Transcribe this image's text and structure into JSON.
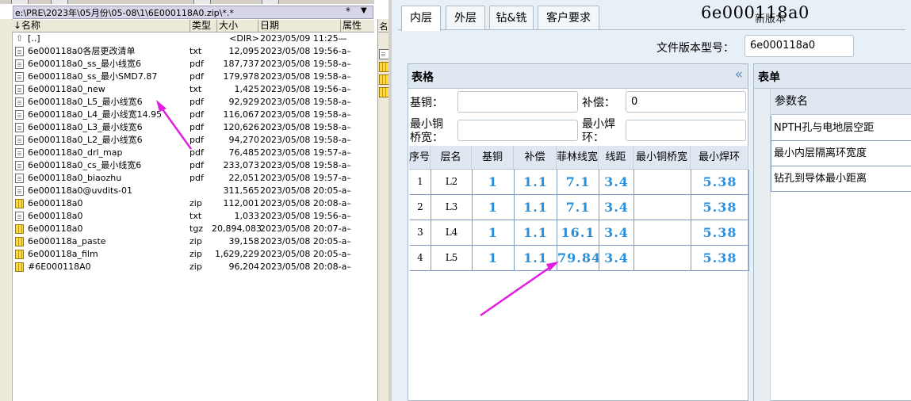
{
  "file_manager": {
    "path": "e:\\PRE\\2023年\\05月份\\05-08\\1\\6E000118A0.zip\\*.*",
    "path_star": "*",
    "path_dropdown_glyph": "▼",
    "columns": {
      "name": "↓名称",
      "type": "类型",
      "size": "大小",
      "date": "日期",
      "attr": "属性"
    },
    "right_column_header": "名",
    "files": [
      {
        "icon": "up-icon",
        "name": "[..]",
        "type": "",
        "size": "<DIR>",
        "date": "2023/05/09 11:25—"
      },
      {
        "icon": "txt-icon",
        "name": "6e000118a0各层更改清单",
        "type": "txt",
        "size": "12,095",
        "date": "2023/05/08 19:56-a–"
      },
      {
        "icon": "txt-icon",
        "name": "6e000118a0_ss_最小线宽6",
        "type": "pdf",
        "size": "187,737",
        "date": "2023/05/08 19:58-a–"
      },
      {
        "icon": "txt-icon",
        "name": "6e000118a0_ss_最小SMD7.87",
        "type": "pdf",
        "size": "179,978",
        "date": "2023/05/08 19:58-a–"
      },
      {
        "icon": "txt-icon",
        "name": "6e000118a0_new",
        "type": "txt",
        "size": "1,425",
        "date": "2023/05/08 19:56-a–"
      },
      {
        "icon": "txt-icon",
        "name": "6e000118a0_L5_最小线宽6",
        "type": "pdf",
        "size": "92,929",
        "date": "2023/05/08 19:58-a–"
      },
      {
        "icon": "txt-icon",
        "name": "6e000118a0_L4_最小线宽14.95",
        "type": "pdf",
        "size": "116,067",
        "date": "2023/05/08 19:58-a–"
      },
      {
        "icon": "txt-icon",
        "name": "6e000118a0_L3_最小线宽6",
        "type": "pdf",
        "size": "120,626",
        "date": "2023/05/08 19:58-a–"
      },
      {
        "icon": "txt-icon",
        "name": "6e000118a0_L2_最小线宽6",
        "type": "pdf",
        "size": "94,270",
        "date": "2023/05/08 19:58-a–"
      },
      {
        "icon": "txt-icon",
        "name": "6e000118a0_drl_map",
        "type": "pdf",
        "size": "76,485",
        "date": "2023/05/08 19:57-a–"
      },
      {
        "icon": "txt-icon",
        "name": "6e000118a0_cs_最小线宽6",
        "type": "pdf",
        "size": "233,073",
        "date": "2023/05/08 19:58-a–"
      },
      {
        "icon": "txt-icon",
        "name": "6e000118a0_biaozhu",
        "type": "pdf",
        "size": "22,051",
        "date": "2023/05/08 19:57-a–"
      },
      {
        "icon": "txt-icon",
        "name": "6e000118a0@uvdits-01",
        "type": "",
        "size": "311,565",
        "date": "2023/05/08 20:05-a–"
      },
      {
        "icon": "zip-icon",
        "name": "6e000118a0",
        "type": "zip",
        "size": "112,001",
        "date": "2023/05/08 20:08-a–"
      },
      {
        "icon": "txt-icon",
        "name": "6e000118a0",
        "type": "txt",
        "size": "1,033",
        "date": "2023/05/08 19:56-a–"
      },
      {
        "icon": "zip-icon",
        "name": "6e000118a0",
        "type": "tgz",
        "size": "20,894,083",
        "date": "2023/05/08 20:07-a–"
      },
      {
        "icon": "zip-icon",
        "name": "6e000118a_paste",
        "type": "zip",
        "size": "39,158",
        "date": "2023/05/08 20:05-a–"
      },
      {
        "icon": "zip-icon",
        "name": "6e000118a_film",
        "type": "zip",
        "size": "1,629,229",
        "date": "2023/05/08 20:05-a–"
      },
      {
        "icon": "zip-icon",
        "name": "#6E000118A0",
        "type": "zip",
        "size": "96,204",
        "date": "2023/05/08 20:08-a–"
      }
    ]
  },
  "app": {
    "tabs": [
      "内层",
      "外层",
      "钻&铣",
      "客户要求"
    ],
    "active_tab": "内层",
    "version_title": "6e000118a0",
    "version_button": "新版本",
    "file_version_label": "文件版本型号：",
    "file_version_value": "6e000118a0",
    "table_panel": {
      "title": "表格",
      "collapse_glyph": "«",
      "fields": {
        "base_copper_label": "基铜：",
        "base_copper_value": "",
        "compensation_label": "补偿：",
        "compensation_value": "0",
        "min_copper_bridge_label": "最小铜桥宽：",
        "min_copper_bridge_value": "",
        "min_annular_ring_label": "最小焊环：",
        "min_annular_ring_value": ""
      },
      "columns": [
        "序号",
        "层名",
        "基铜",
        "补偿",
        "菲林线宽",
        "线距",
        "最小铜桥宽",
        "最小焊环"
      ],
      "rows": [
        {
          "index": "1",
          "layer": "L2",
          "base": "1",
          "comp": "1.1",
          "film": "7.1",
          "spacing": "3.4",
          "bridge": "",
          "ring": "5.38"
        },
        {
          "index": "2",
          "layer": "L3",
          "base": "1",
          "comp": "1.1",
          "film": "7.1",
          "spacing": "3.4",
          "bridge": "",
          "ring": "5.38"
        },
        {
          "index": "3",
          "layer": "L4",
          "base": "1",
          "comp": "1.1",
          "film": "16.1",
          "spacing": "3.4",
          "bridge": "",
          "ring": "5.38"
        },
        {
          "index": "4",
          "layer": "L5",
          "base": "1",
          "comp": "1.1",
          "film": "79.84",
          "spacing": "3.4",
          "bridge": "",
          "ring": "5.38"
        }
      ]
    },
    "form_panel": {
      "title": "表单",
      "param_header": "参数名",
      "params": [
        "NPTH孔与电地层空距",
        "最小内层隔离环宽度",
        "钻孔到导体最小距离"
      ]
    }
  },
  "colors": {
    "annotation_arrow": "#e020e0",
    "value_blue": "#2a8fd8",
    "grid_border": "#7f9cc0"
  }
}
